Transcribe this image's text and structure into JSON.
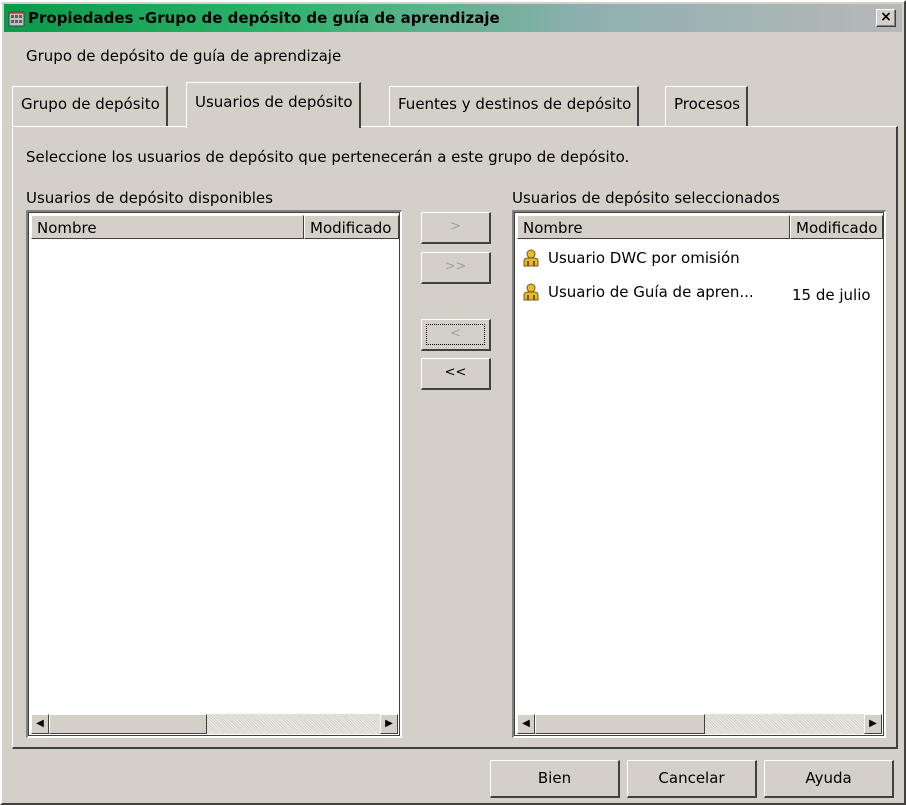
{
  "window": {
    "title": "Propiedades -Grupo de depósito de guía de aprendizaje",
    "close_label": "×",
    "subtitle": "Grupo de depósito de guía de aprendizaje"
  },
  "tabs": [
    {
      "label": "Grupo de depósito",
      "active": false
    },
    {
      "label": "Usuarios de depósito",
      "active": true
    },
    {
      "label": "Fuentes y destinos de depósito",
      "active": false
    },
    {
      "label": "Procesos",
      "active": false
    }
  ],
  "panel": {
    "instruction": "Seleccione los usuarios de depósito que pertenecerán a este grupo de depósito.",
    "available": {
      "label": "Usuarios de depósito disponibles",
      "columns": [
        "Nombre",
        "Modificado"
      ],
      "rows": []
    },
    "selected": {
      "label": "Usuarios de depósito seleccionados",
      "columns": [
        "Nombre",
        "Modificado"
      ],
      "rows": [
        {
          "name": "Usuario DWC por omisión",
          "modified": ""
        },
        {
          "name": "Usuario de Guía de apren...",
          "modified": "15 de julio"
        }
      ]
    },
    "move_buttons": {
      "add": ">",
      "add_all": ">>",
      "remove": "<",
      "remove_all": "<<"
    }
  },
  "buttons": {
    "ok": "Bien",
    "cancel": "Cancelar",
    "help": "Ayuda"
  },
  "colors": {
    "titlebar_start": "#0a9a4a",
    "dialog_bg": "#d4d0c8",
    "user_icon": "#e8b830"
  }
}
